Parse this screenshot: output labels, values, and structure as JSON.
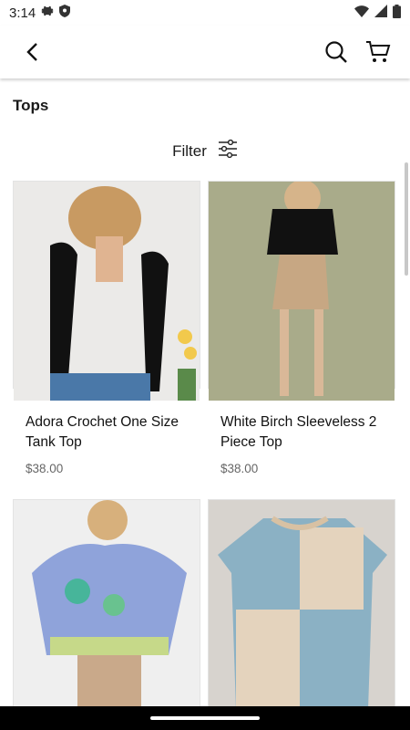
{
  "status": {
    "time": "3:14"
  },
  "header": {
    "back_icon": "chevron-left-icon",
    "search_icon": "search-icon",
    "cart_icon": "cart-icon"
  },
  "category": {
    "title": "Tops"
  },
  "filter": {
    "label": "Filter",
    "icon": "sliders-icon"
  },
  "products": [
    {
      "title": "Adora Crochet One Size Tank Top",
      "price": "$38.00",
      "image_desc": "black crochet tank"
    },
    {
      "title": "White Birch Sleeveless 2 Piece Top",
      "price": "$38.00",
      "image_desc": "black lace top tan skort"
    },
    {
      "title": "",
      "price": "",
      "image_desc": "tropical print blouse"
    },
    {
      "title": "",
      "price": "",
      "image_desc": "blue floral patchwork tee"
    }
  ],
  "colors": {
    "accent": "#1a1a1a",
    "price": "#666666"
  }
}
